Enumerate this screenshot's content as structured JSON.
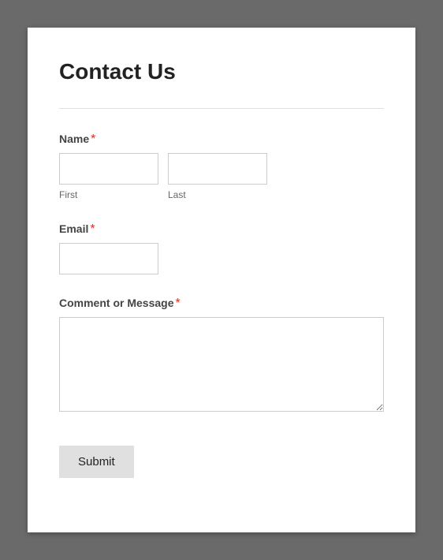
{
  "form": {
    "title": "Contact Us",
    "required_marker": "*",
    "fields": {
      "name": {
        "label": "Name",
        "required": true,
        "first": {
          "sublabel": "First",
          "value": ""
        },
        "last": {
          "sublabel": "Last",
          "value": ""
        }
      },
      "email": {
        "label": "Email",
        "required": true,
        "value": ""
      },
      "message": {
        "label": "Comment or Message",
        "required": true,
        "value": ""
      }
    },
    "submit_label": "Submit"
  }
}
